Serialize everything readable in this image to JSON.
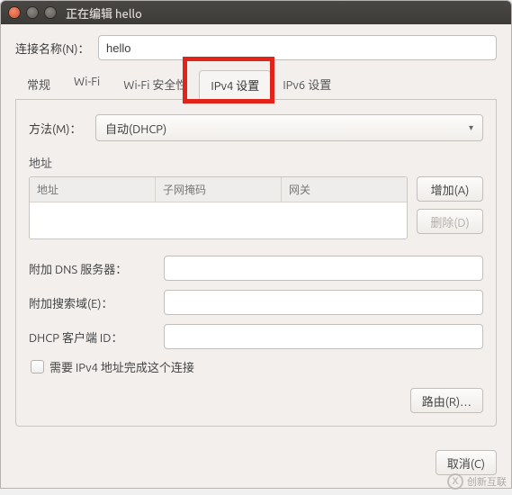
{
  "window": {
    "title": "正在编辑 hello"
  },
  "connection": {
    "name_label": "连接名称(N)：",
    "name_value": "hello"
  },
  "tabs": {
    "general": "常规",
    "wifi": "Wi-Fi",
    "wifi_security": "Wi-Fi 安全性",
    "ipv4": "IPv4 设置",
    "ipv6": "IPv6 设置"
  },
  "ipv4": {
    "method_label": "方法(M)：",
    "method_value": "自动(DHCP)",
    "addresses_label": "地址",
    "col_address": "地址",
    "col_netmask": "子网掩码",
    "col_gateway": "网关",
    "add_btn": "增加(A)",
    "delete_btn": "删除(D)",
    "dns_label": "附加 DNS 服务器：",
    "search_label": "附加搜索域(E)：",
    "dhcp_client_id_label": "DHCP 客户端 ID：",
    "require_checkbox": "需要 IPv4 地址完成这个连接",
    "routes_btn": "路由(R)…"
  },
  "footer": {
    "cancel": "取消(C)"
  },
  "watermark": {
    "text": "创新互联"
  }
}
